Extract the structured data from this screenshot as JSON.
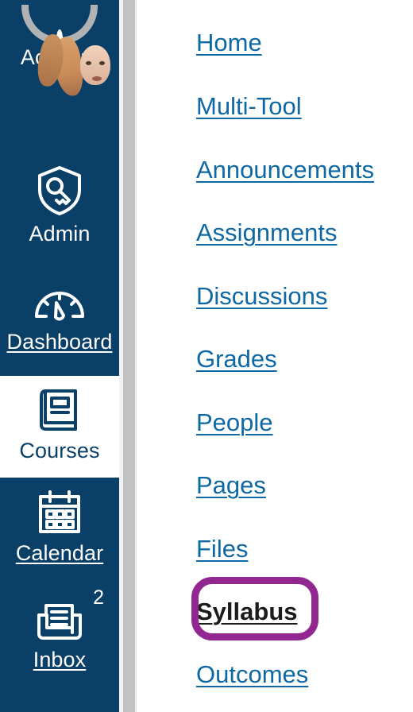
{
  "global_nav": {
    "logo": {
      "icon": "canvas-logo-circle"
    },
    "items": [
      {
        "id": "account",
        "label": "Account",
        "icon": "user-avatar-icon",
        "state": "default",
        "badge": null
      },
      {
        "id": "admin",
        "label": "Admin",
        "icon": "shield-key-icon",
        "state": "default",
        "badge": null
      },
      {
        "id": "dashboard",
        "label": "Dashboard",
        "icon": "speedometer-icon",
        "state": "underlined",
        "badge": null
      },
      {
        "id": "courses",
        "label": "Courses",
        "icon": "book-icon",
        "state": "active",
        "badge": null
      },
      {
        "id": "calendar",
        "label": "Calendar",
        "icon": "calendar-icon",
        "state": "underlined",
        "badge": null
      },
      {
        "id": "inbox",
        "label": "Inbox",
        "icon": "inbox-tray-icon",
        "state": "underlined",
        "badge": "2"
      }
    ]
  },
  "scrollbar": {
    "orientation": "vertical",
    "thumb_label": "vertical-scrollbar-thumb"
  },
  "course_nav": {
    "items": [
      {
        "id": "home",
        "label": "Home",
        "current": false
      },
      {
        "id": "multi-tool",
        "label": "Multi-Tool",
        "current": false
      },
      {
        "id": "announcements",
        "label": "Announcements",
        "current": false
      },
      {
        "id": "assignments",
        "label": "Assignments",
        "current": false
      },
      {
        "id": "discussions",
        "label": "Discussions",
        "current": false
      },
      {
        "id": "grades",
        "label": "Grades",
        "current": false
      },
      {
        "id": "people",
        "label": "People",
        "current": false
      },
      {
        "id": "pages",
        "label": "Pages",
        "current": false
      },
      {
        "id": "files",
        "label": "Files",
        "current": false
      },
      {
        "id": "syllabus",
        "label": "Syllabus",
        "current": true
      },
      {
        "id": "outcomes",
        "label": "Outcomes",
        "current": false
      }
    ]
  },
  "annotation": {
    "target": "Syllabus",
    "shape": "rounded-rectangle-outline",
    "color": "#932791"
  },
  "colors": {
    "nav_background": "#0A4068",
    "nav_text": "#FFFFFF",
    "link": "#0E68A3",
    "active_background": "#FFFFFF",
    "active_text": "#0A4068",
    "highlight": "#932791",
    "scrollbar_thumb": "#C0C2C4",
    "scrollbar_track": "#F2F3F4"
  }
}
